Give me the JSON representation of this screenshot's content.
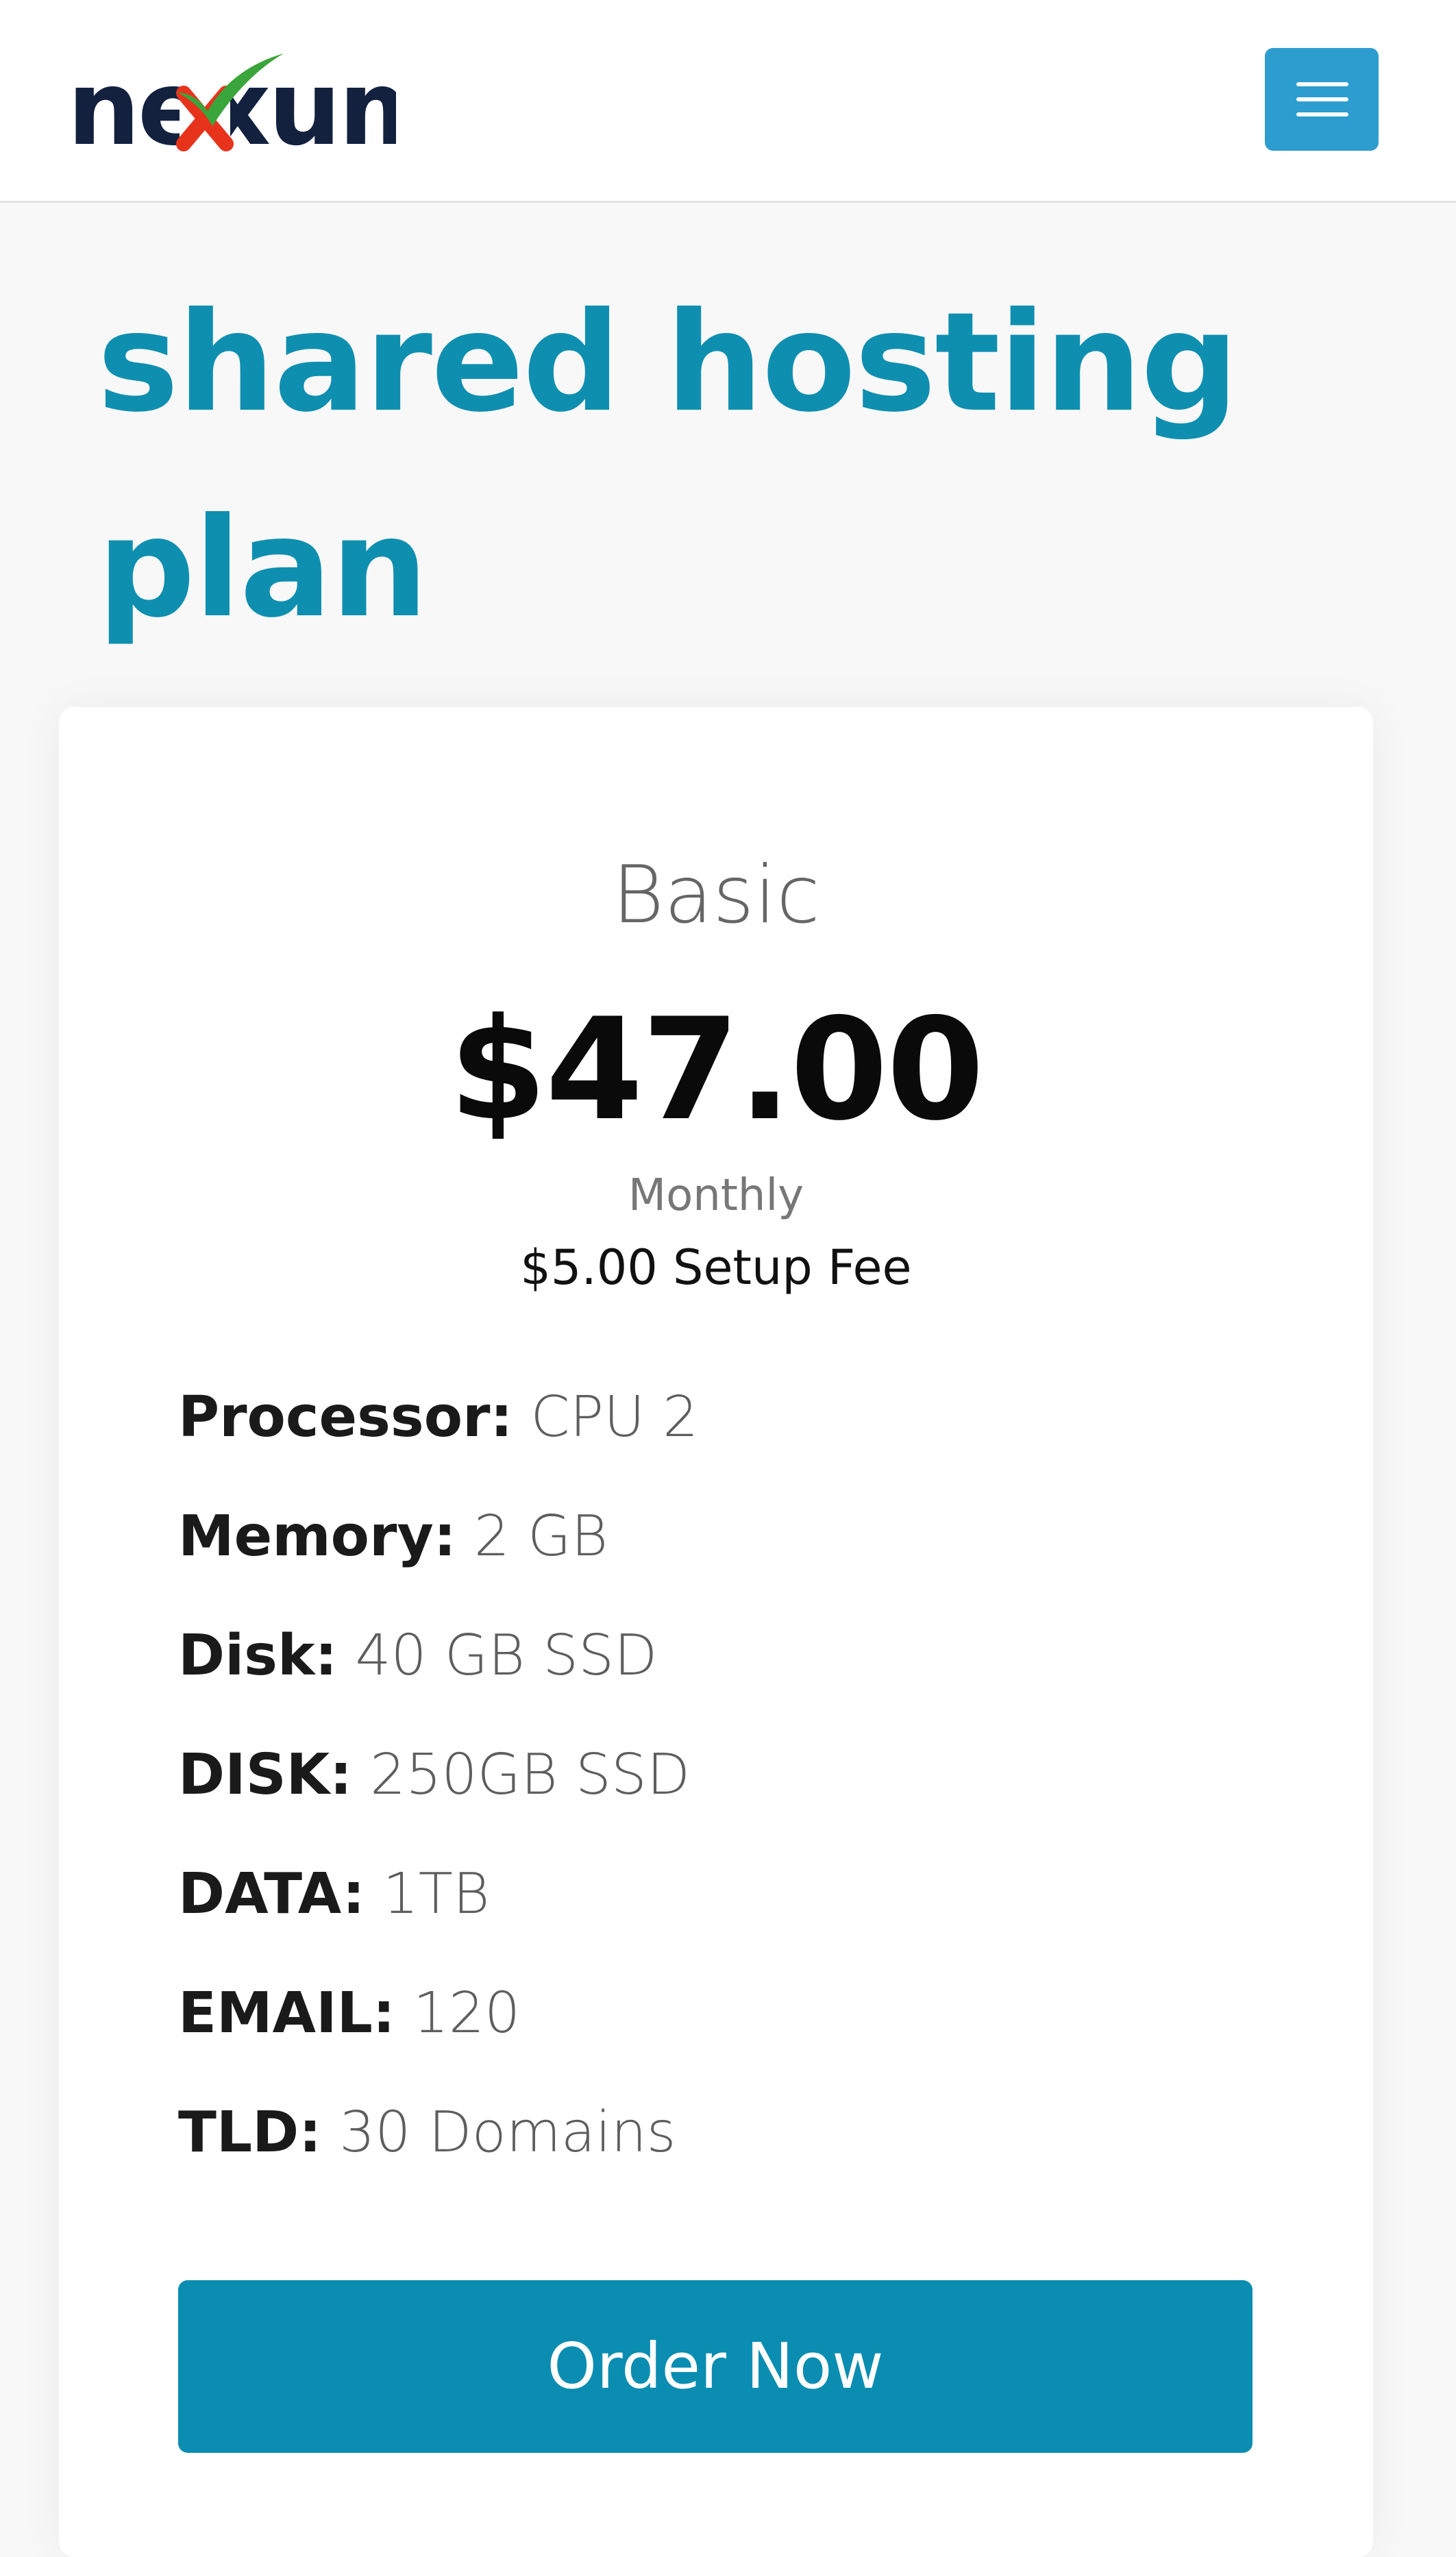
{
  "brand": {
    "logo_text": "nexum",
    "colors": {
      "logo_dark": "#13213f",
      "logo_x_red": "#e8331c",
      "logo_check_green": "#3aa53a"
    }
  },
  "header": {
    "menu_icon": "hamburger-icon",
    "menu_button_color": "#2d9dcf"
  },
  "page": {
    "title": "shared hosting plan",
    "title_color": "#0f8fb0"
  },
  "plan": {
    "name": "Basic",
    "price": "$47.00",
    "period": "Monthly",
    "setup_fee": "$5.00 Setup Fee",
    "features": [
      {
        "label": "Processor:",
        "value": "CPU 2"
      },
      {
        "label": "Memory:",
        "value": "2 GB"
      },
      {
        "label": "Disk:",
        "value": "40 GB SSD"
      },
      {
        "label": "DISK:",
        "value": "250GB SSD"
      },
      {
        "label": "DATA:",
        "value": "1TB"
      },
      {
        "label": "EMAIL:",
        "value": "120"
      },
      {
        "label": "TLD:",
        "value": "30 Domains"
      }
    ],
    "order_label": "Order Now",
    "order_button_color": "#0a8db1"
  }
}
